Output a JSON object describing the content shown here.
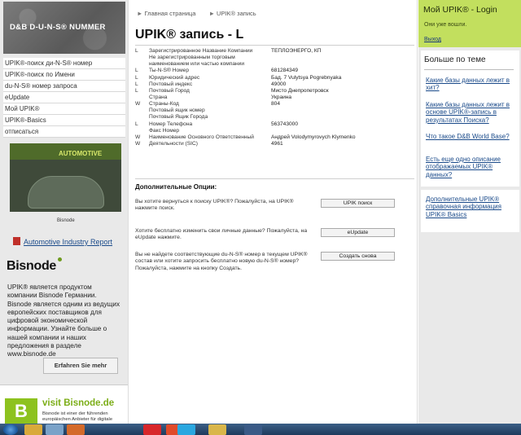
{
  "left": {
    "banner_title": "D&B D-U-N-S® NUMMER",
    "nav": [
      "UPIK®-поиск ди-N-S® номер",
      "UPIK®-поиск по Имени",
      "du-N-S® номер запроса",
      "eUpdate",
      "Мой UPIK®",
      "UPIK®-Basics",
      "отписаться"
    ],
    "ad_label": "AUTOMOTIVE",
    "ad_brand": "Bisnode",
    "ad_link": "Automotive Industry Report",
    "bisnode_logo": "Bisnode",
    "bisnode_text": "UPIK® является продуктом компании Bisnode Германии. Bisnode является одним из ведущих европейских поставщиков для цифровой экономической информации. Узнайте больше о нашей компании и наших предложения в разделе www.bisnode.de",
    "erfahren_button": "Erfahren Sie mehr",
    "visit_logo_letter": "B",
    "visit_text": "visit Bisnode.de",
    "visit_small": "Bisnode ist einer der führenden europäischen Anbieter für digitale"
  },
  "main": {
    "breadcrumb": [
      "Главная страница",
      "UPIK® запись"
    ],
    "title": "UPIK® запись - L",
    "rows": [
      {
        "flag": "L",
        "label": "Зарегистрированное Название Компании",
        "value": "ТЕПЛОЭНЕРГО, КП"
      },
      {
        "flag": "",
        "label": "Не зарегистрированным торговым",
        "value": ""
      },
      {
        "flag": "",
        "label": "наименованием или частью компании",
        "value": ""
      },
      {
        "flag": "L",
        "label": "Ты-N-S® Номер",
        "value": "681284349"
      },
      {
        "flag": "L",
        "label": "Юридический адрес",
        "value": "Бад. 7 Vulytsya Pogrebnyaka"
      },
      {
        "flag": "L",
        "label": "Почтовый индекс",
        "value": "49000"
      },
      {
        "flag": "L",
        "label": "Почтовый Город",
        "value": "Мисто Днепропетровск"
      },
      {
        "flag": "",
        "label": "Страна",
        "value": "Украина"
      },
      {
        "flag": "W",
        "label": "Страны-Код",
        "value": "804"
      },
      {
        "flag": "",
        "label": "Почтовый ящик номер",
        "value": ""
      },
      {
        "flag": "",
        "label": "Почтовый Ящик Города",
        "value": ""
      },
      {
        "flag": "L",
        "label": "Номер Телефона",
        "value": "563743000"
      },
      {
        "flag": "",
        "label": "Факс Номер",
        "value": ""
      },
      {
        "flag": "W",
        "label": "Наименование Основного Ответственный",
        "value": "Андрей Volodymyrovych Klymenko"
      },
      {
        "flag": "W",
        "label": "Деятельности (SIC)",
        "value": "4961"
      }
    ],
    "options_title": "Дополнительные Опции:",
    "options": [
      {
        "text": "Вы хотите вернуться к поиску UPIK®? Пожалуйста, на UPIK® нажмите поиск.",
        "button": "UPIK поиск"
      },
      {
        "text": "Хотите бесплатно изменить свои личные данные? Пожалуйста, на eUpdate нажмите.",
        "button": "eUpdate"
      },
      {
        "text": "Вы не найдете соответствующие du-N-S® номер в текущем UPIK® состав или хотите запросить бесплатно новую du-N-S® номер? Пожалуйста, нажмите на кнопку Создать.",
        "button": "Создать снова"
      }
    ]
  },
  "right": {
    "login_title": "Мой UPIK® - Login",
    "login_status": "Они уже вошли.",
    "logout": "Выход",
    "more_title": "Больше по теме",
    "links": [
      "Какие базы данных лежит в хит?",
      "Какие базы данных лежит в основе UPIK®-запись в результатах Поиска?",
      "Что такое D&B World Base?",
      "Есть еще одно описание отображаемых UPIK® данных?"
    ],
    "info_link": "Дополнительные UPIK® справочная информация UPIK® Basics"
  },
  "colors": {
    "accent_green": "#c2df5e",
    "link": "#1a4a8a",
    "bisnode_green": "#8dc21f"
  }
}
